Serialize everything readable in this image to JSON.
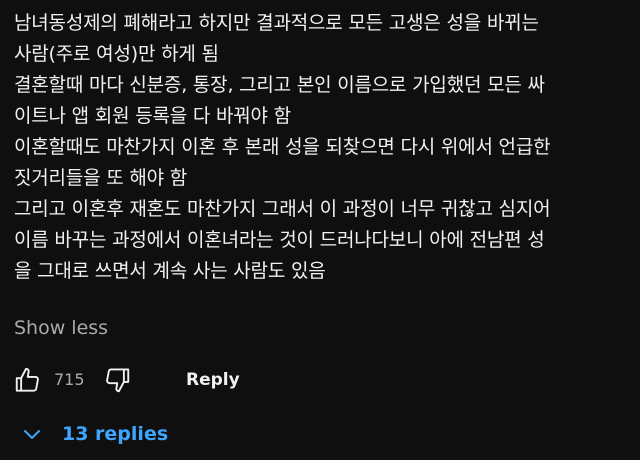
{
  "comment": {
    "lines": [
      "남녀동성제의 폐해라고 하지만 결과적으로 모든 고생은 성을 바뀌는",
      "사람(주로 여성)만 하게 됨",
      "결혼할때 마다 신분증, 통장, 그리고 본인 이름으로 가입했던 모든 싸",
      "이트나 앱 회원 등록을 다 바꿔야 함",
      "이혼할때도 마찬가지 이혼 후 본래 성을 되찾으면 다시 위에서 언급한",
      "짓거리들을 또 해야 함",
      "그리고 이혼후 재혼도 마찬가지 그래서 이 과정이 너무 귀찮고 심지어",
      "이름 바꾸는 과정에서 이혼녀라는 것이 드러나다보니 아에 전남편 성",
      "을 그대로 쓰면서 계속 사는 사람도 있음"
    ],
    "show_less_label": "Show less"
  },
  "actions": {
    "like_icon": "thumbs-up-icon",
    "like_count": "715",
    "dislike_icon": "thumbs-down-icon",
    "reply_label": "Reply"
  },
  "replies": {
    "toggle_icon": "chevron-down-icon",
    "label": "13 replies",
    "accent_color": "#3ea6ff"
  },
  "colors": {
    "background": "#0f0f0f",
    "text": "#f1f1f1",
    "secondary_text": "#aaaaaa"
  }
}
